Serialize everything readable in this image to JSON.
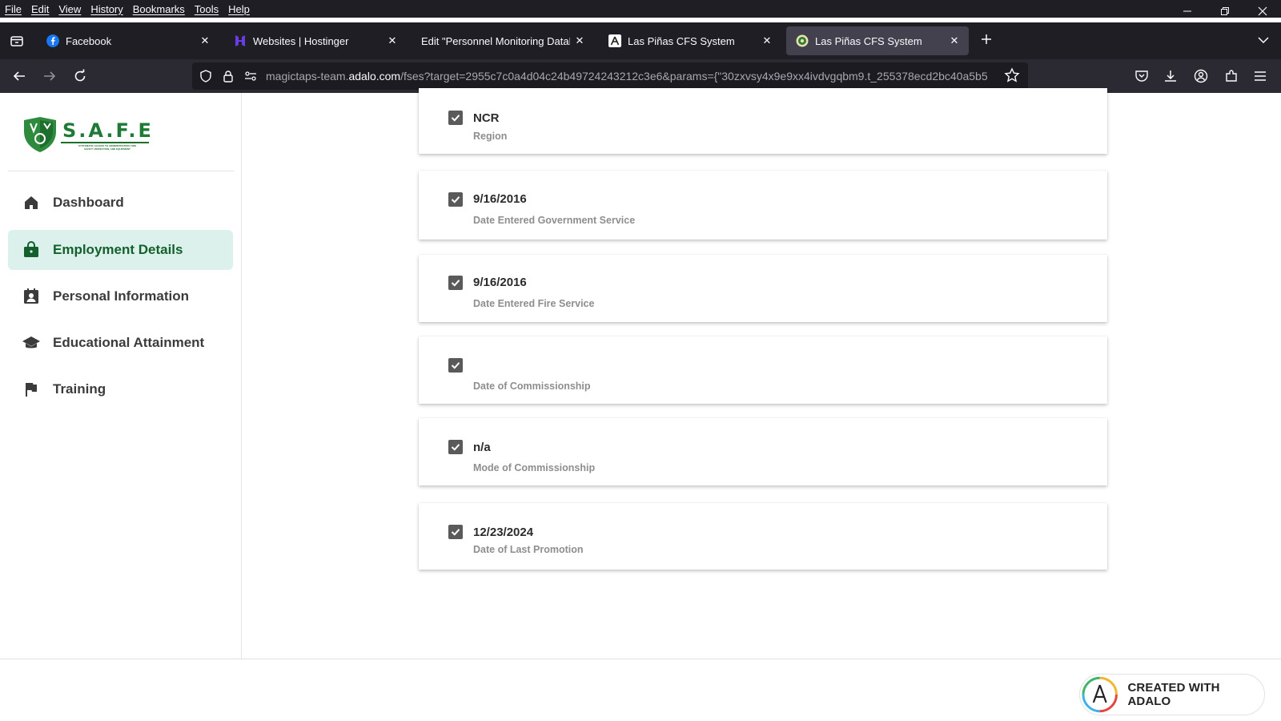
{
  "menu": [
    "File",
    "Edit",
    "View",
    "History",
    "Bookmarks",
    "Tools",
    "Help"
  ],
  "tabs": [
    {
      "title": "Facebook",
      "favicon": "facebook-icon"
    },
    {
      "title": "Websites | Hostinger",
      "favicon": "hostinger-icon"
    },
    {
      "title": "Edit \"Personnel Monitoring DataBas",
      "favicon": ""
    },
    {
      "title": "Las Piñas CFS System",
      "favicon": "adalo-icon"
    },
    {
      "title": "Las Piñas CFS System",
      "favicon": "safe-logo-icon",
      "active": true
    }
  ],
  "url": {
    "prefix": "magictaps-team.",
    "domain": "adalo.com",
    "path": "/fses?target=2955c7c0a4d04c24b49724243212c3e6&params={\"30zxvsy4x9e9xx4ivdvgqbm9.t_255378ecd2bc40a5b5"
  },
  "sidebar": {
    "logo_text": "S.A.F.E",
    "logo_subtext": "SYSTEMATIC ACCESS TO ADMINISTRATION, FIRE SAFETY INSPECTION, AND EQUIPMENT",
    "items": [
      {
        "label": "Dashboard",
        "icon": "home-icon"
      },
      {
        "label": "Employment Details",
        "icon": "briefcase-icon",
        "active": true
      },
      {
        "label": "Personal Information",
        "icon": "contact-card-icon"
      },
      {
        "label": "Educational Attainment",
        "icon": "graduation-cap-icon"
      },
      {
        "label": "Training",
        "icon": "flag-icon"
      }
    ]
  },
  "records": [
    {
      "value": "NCR",
      "label": "Region"
    },
    {
      "value": "9/16/2016",
      "label": "Date Entered Government Service"
    },
    {
      "value": "9/16/2016",
      "label": "Date Entered Fire Service"
    },
    {
      "value": "",
      "label": "Date of Commissionship"
    },
    {
      "value": "n/a",
      "label": "Mode of Commissionship"
    },
    {
      "value": "12/23/2024",
      "label": "Date of Last Promotion"
    }
  ],
  "footer": {
    "badge": "CREATED WITH ADALO"
  },
  "colors": {
    "active_bg": "#dcf1ec",
    "active_text": "#14602c",
    "chrome_bg": "#1f1e25",
    "navbar_bg": "#2b2a33"
  }
}
